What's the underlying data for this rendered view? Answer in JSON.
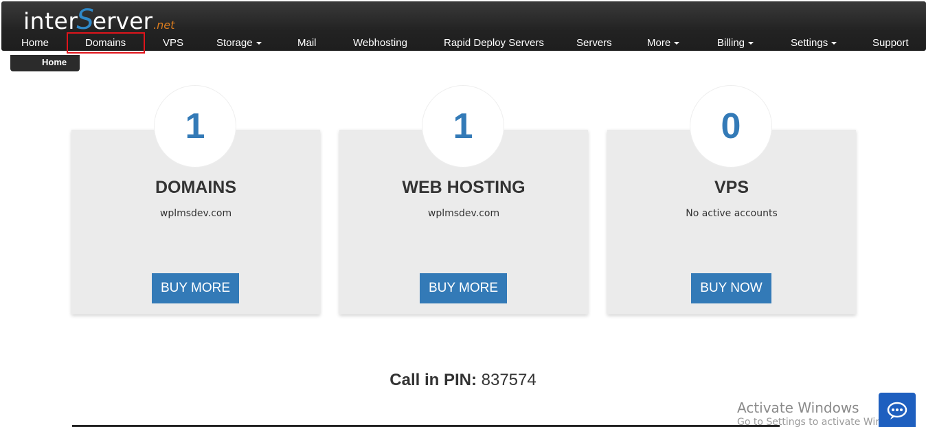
{
  "logo": {
    "part1": "inter",
    "part2": "S",
    "part3": "erver",
    "part4": ".net"
  },
  "nav": {
    "items": [
      {
        "label": "Home",
        "dropdown": false
      },
      {
        "label": "Domains",
        "dropdown": false
      },
      {
        "label": "VPS",
        "dropdown": false
      },
      {
        "label": "Storage",
        "dropdown": true
      },
      {
        "label": "Mail",
        "dropdown": false
      },
      {
        "label": "Webhosting",
        "dropdown": false
      },
      {
        "label": "Rapid Deploy Servers",
        "dropdown": false
      },
      {
        "label": "Servers",
        "dropdown": false
      },
      {
        "label": "More",
        "dropdown": true
      },
      {
        "label": "Billing",
        "dropdown": true
      },
      {
        "label": "Settings",
        "dropdown": true
      },
      {
        "label": "Support",
        "dropdown": false
      }
    ]
  },
  "breadcrumb": {
    "label": "Home"
  },
  "cards": [
    {
      "count": "1",
      "title": "DOMAINS",
      "subtitle": "wplmsdev.com",
      "button": "BUY MORE"
    },
    {
      "count": "1",
      "title": "WEB HOSTING",
      "subtitle": "wplmsdev.com",
      "button": "BUY MORE"
    },
    {
      "count": "0",
      "title": "VPS",
      "subtitle": "No active accounts",
      "button": "BUY NOW"
    }
  ],
  "pin": {
    "label": "Call in PIN:",
    "value": "837574"
  },
  "watermark": {
    "title": "Activate Windows",
    "subtitle": "Go to Settings to activate Windows."
  },
  "colors": {
    "accent": "#337ab7",
    "topbar": "#2a2a2a",
    "highlight": "#e0141b",
    "card_bg": "#ebebeb"
  },
  "icons": {
    "chat": "chat-bubble-icon",
    "caret": "caret-down-icon"
  }
}
